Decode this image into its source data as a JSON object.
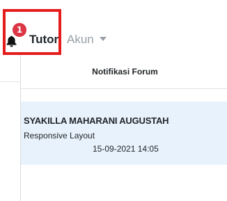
{
  "navbar": {
    "notification_count": "1",
    "tutor_label": "Tutor",
    "akun_label": "Akun"
  },
  "dropdown": {
    "title": "Notifikasi Forum",
    "items": [
      {
        "name": "SYAKILLA MAHARANI AUGUSTAH",
        "topic": "Responsive Layout",
        "datetime": "15-09-2021 14:05"
      }
    ]
  },
  "colors": {
    "badge": "#dc3545",
    "highlight": "#e41c1c",
    "item_background": "#e8f2fc"
  },
  "icons": {
    "notification": "bell-icon",
    "dropdown": "caret-down-icon"
  }
}
